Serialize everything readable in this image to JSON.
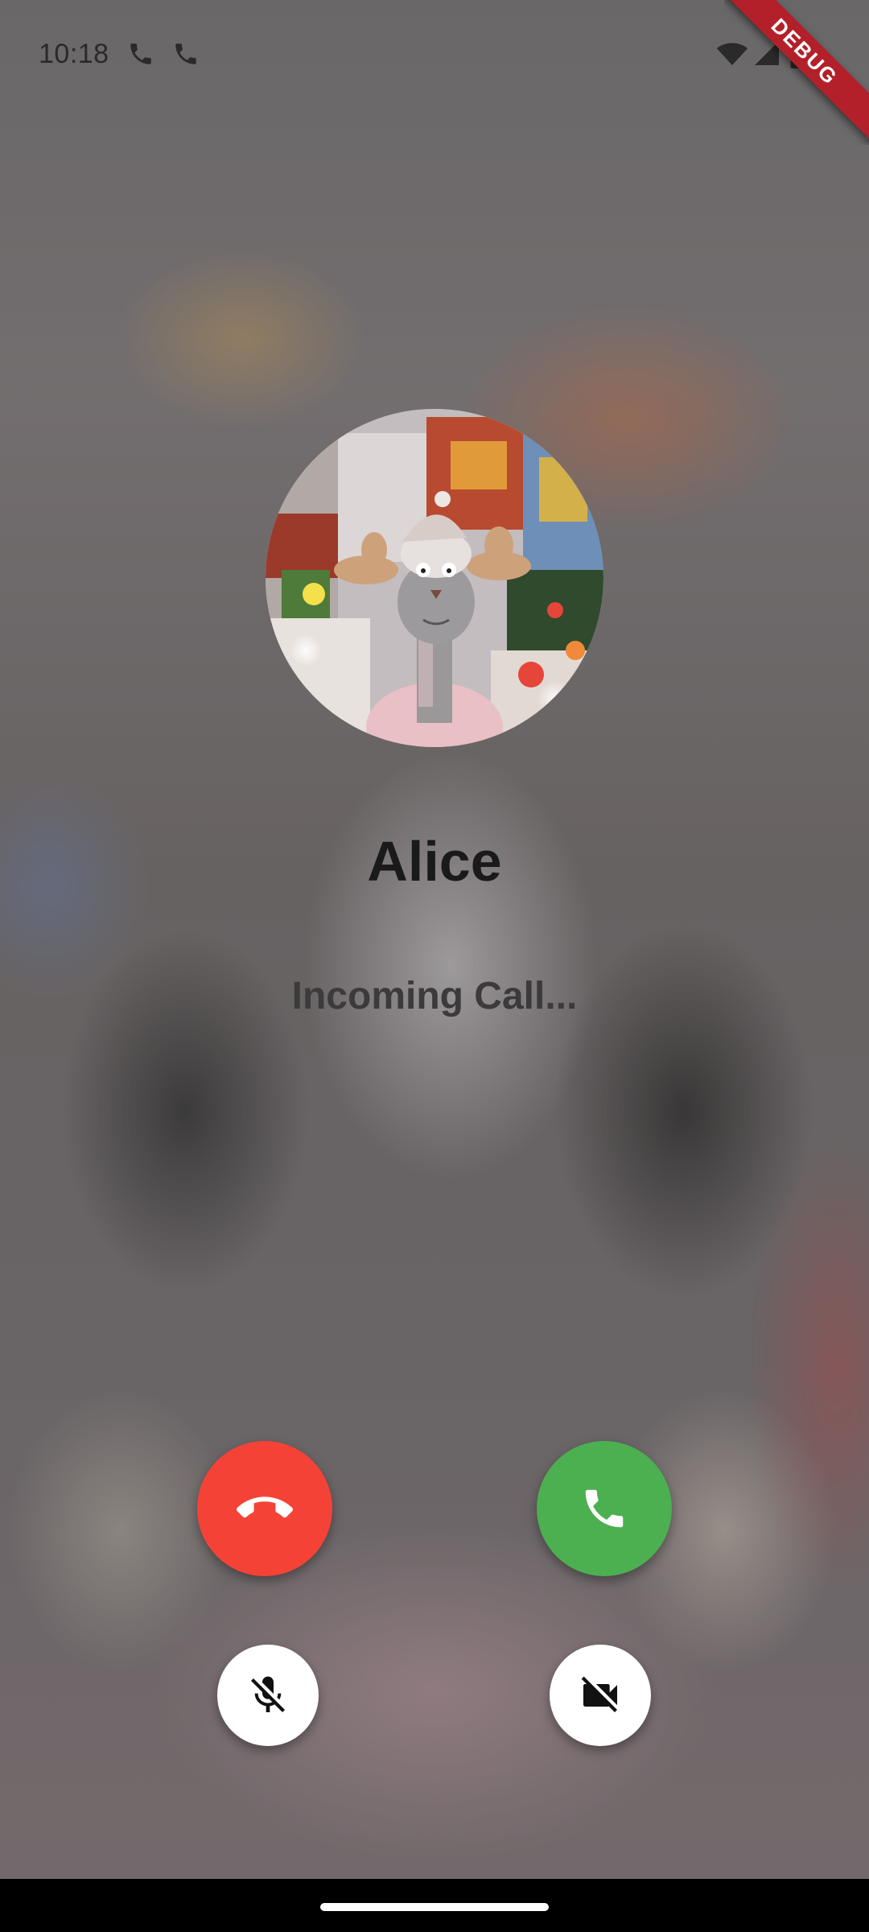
{
  "status_bar": {
    "time": "10:18",
    "icons": [
      "phone-icon",
      "phone-icon",
      "wifi-icon",
      "signal-icon",
      "battery-icon"
    ]
  },
  "debug_banner": {
    "label": "DEBUG",
    "color": "#b3202a"
  },
  "caller": {
    "name": "Alice",
    "status": "Incoming Call..."
  },
  "actions": {
    "decline": {
      "icon": "call-end-icon",
      "color": "#f44336"
    },
    "accept": {
      "icon": "phone-icon",
      "color": "#4caf50"
    },
    "mute": {
      "icon": "mic-off-icon",
      "color": "#ffffff"
    },
    "video": {
      "icon": "videocam-off-icon",
      "color": "#ffffff"
    }
  }
}
